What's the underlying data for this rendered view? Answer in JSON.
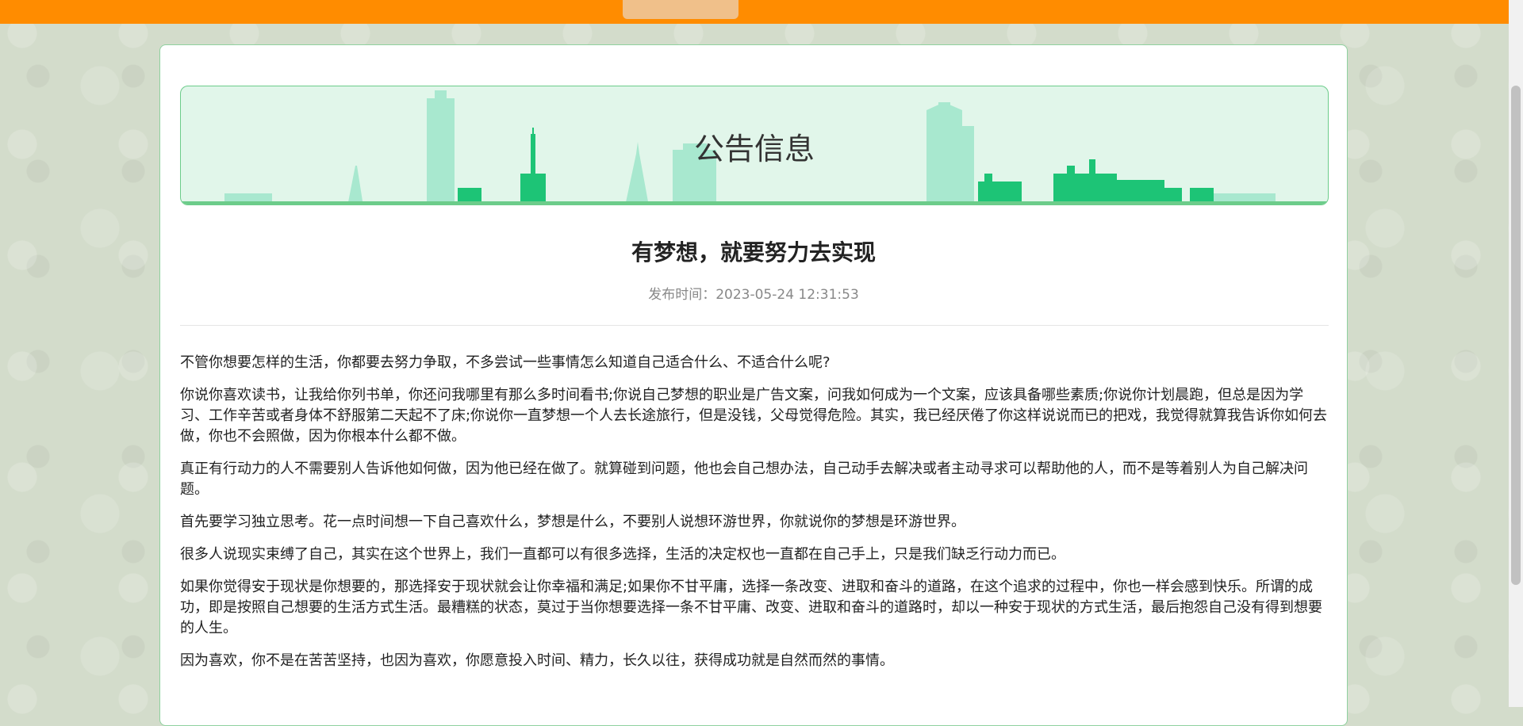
{
  "colors": {
    "nav_bg": "#ff8c00",
    "accent": "#1dc476",
    "banner_bg": "#e1f6ea"
  },
  "banner": {
    "title": "公告信息"
  },
  "article": {
    "title": "有梦想，就要努力去实现",
    "publish_time": "发布时间：2023-05-24 12:31:53",
    "paragraphs": [
      "不管你想要怎样的生活，你都要去努力争取，不多尝试一些事情怎么知道自己适合什么、不适合什么呢?",
      "你说你喜欢读书，让我给你列书单，你还问我哪里有那么多时间看书;你说自己梦想的职业是广告文案，问我如何成为一个文案，应该具备哪些素质;你说你计划晨跑，但总是因为学习、工作辛苦或者身体不舒服第二天起不了床;你说你一直梦想一个人去长途旅行，但是没钱，父母觉得危险。其实，我已经厌倦了你这样说说而已的把戏，我觉得就算我告诉你如何去做，你也不会照做，因为你根本什么都不做。",
      "真正有行动力的人不需要别人告诉他如何做，因为他已经在做了。就算碰到问题，他也会自己想办法，自己动手去解决或者主动寻求可以帮助他的人，而不是等着别人为自己解决问题。",
      "首先要学习独立思考。花一点时间想一下自己喜欢什么，梦想是什么，不要别人说想环游世界，你就说你的梦想是环游世界。",
      "很多人说现实束缚了自己，其实在这个世界上，我们一直都可以有很多选择，生活的决定权也一直都在自己手上，只是我们缺乏行动力而已。",
      "如果你觉得安于现状是你想要的，那选择安于现状就会让你幸福和满足;如果你不甘平庸，选择一条改变、进取和奋斗的道路，在这个追求的过程中，你也一样会感到快乐。所谓的成功，即是按照自己想要的生活方式生活。最糟糕的状态，莫过于当你想要选择一条不甘平庸、改变、进取和奋斗的道路时，却以一种安于现状的方式生活，最后抱怨自己没有得到想要的人生。",
      "因为喜欢，你不是在苦苦坚持，也因为喜欢，你愿意投入时间、精力，长久以往，获得成功就是自然而然的事情。"
    ]
  }
}
